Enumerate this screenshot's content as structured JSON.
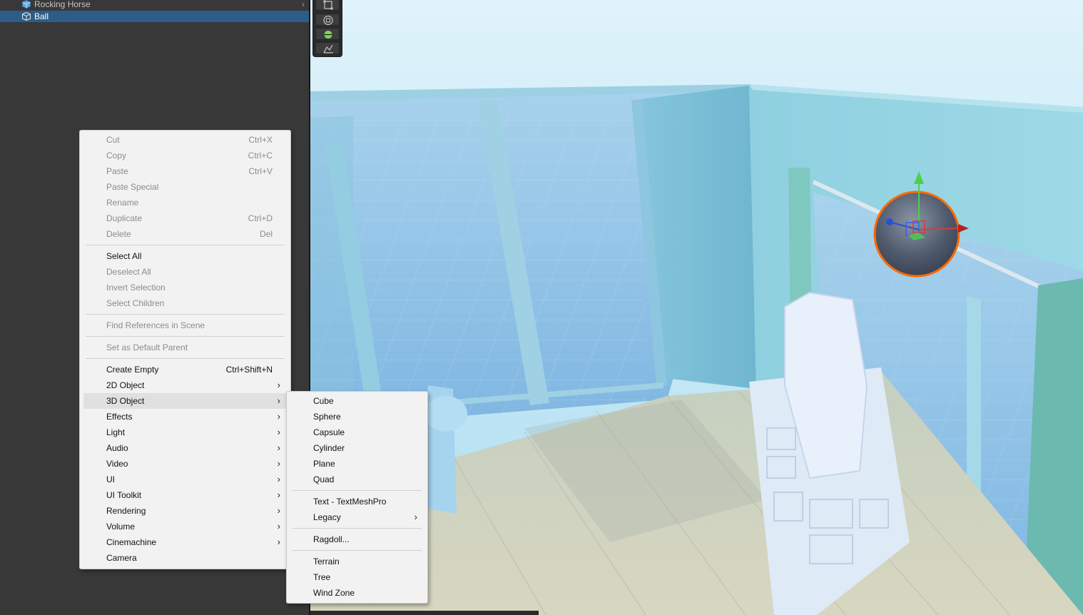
{
  "hierarchy": {
    "items": [
      {
        "label": "Rocking Horse",
        "selected": false
      },
      {
        "label": "Ball",
        "selected": true
      }
    ]
  },
  "toolbar": {
    "tools": [
      "rect-tool-icon",
      "transform-tool-icon",
      "custom-sphere-tool-icon",
      "custom-tool-icon"
    ],
    "active_color": "#7ed957"
  },
  "context_menu": {
    "items": [
      {
        "label": "Cut",
        "shortcut": "Ctrl+X",
        "enabled": false
      },
      {
        "label": "Copy",
        "shortcut": "Ctrl+C",
        "enabled": false
      },
      {
        "label": "Paste",
        "shortcut": "Ctrl+V",
        "enabled": false
      },
      {
        "label": "Paste Special",
        "shortcut": "",
        "enabled": false
      },
      {
        "label": "Rename",
        "shortcut": "",
        "enabled": false
      },
      {
        "label": "Duplicate",
        "shortcut": "Ctrl+D",
        "enabled": false
      },
      {
        "label": "Delete",
        "shortcut": "Del",
        "enabled": false
      },
      {
        "label": "Select All",
        "shortcut": "",
        "enabled": true
      },
      {
        "label": "Deselect All",
        "shortcut": "",
        "enabled": false
      },
      {
        "label": "Invert Selection",
        "shortcut": "",
        "enabled": false
      },
      {
        "label": "Select Children",
        "shortcut": "",
        "enabled": false
      },
      {
        "label": "Find References in Scene",
        "shortcut": "",
        "enabled": false
      },
      {
        "label": "Set as Default Parent",
        "shortcut": "",
        "enabled": false
      },
      {
        "label": "Create Empty",
        "shortcut": "Ctrl+Shift+N",
        "enabled": true
      },
      {
        "label": "2D Object",
        "submenu": true
      },
      {
        "label": "3D Object",
        "submenu": true,
        "highlighted": true
      },
      {
        "label": "Effects",
        "submenu": true
      },
      {
        "label": "Light",
        "submenu": true
      },
      {
        "label": "Audio",
        "submenu": true
      },
      {
        "label": "Video",
        "submenu": true
      },
      {
        "label": "UI",
        "submenu": true
      },
      {
        "label": "UI Toolkit",
        "submenu": true
      },
      {
        "label": "Rendering",
        "submenu": true
      },
      {
        "label": "Volume",
        "submenu": true
      },
      {
        "label": "Cinemachine",
        "submenu": true
      },
      {
        "label": "Camera",
        "submenu": false
      }
    ]
  },
  "submenu_3d_object": {
    "items": [
      {
        "label": "Cube"
      },
      {
        "label": "Sphere"
      },
      {
        "label": "Capsule"
      },
      {
        "label": "Cylinder"
      },
      {
        "label": "Plane"
      },
      {
        "label": "Quad"
      },
      {
        "label": "Text - TextMeshPro"
      },
      {
        "label": "Legacy",
        "submenu": true
      },
      {
        "label": "Ragdoll..."
      },
      {
        "label": "Terrain"
      },
      {
        "label": "Tree"
      },
      {
        "label": "Wind Zone"
      }
    ]
  },
  "chevron": "›"
}
